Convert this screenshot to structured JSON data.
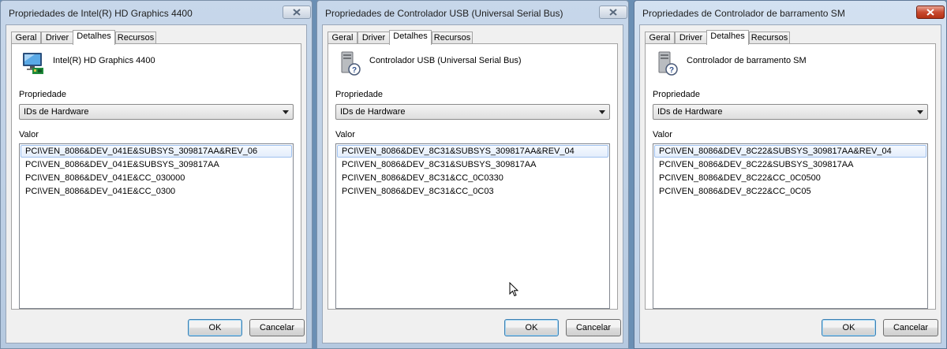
{
  "dialogs": [
    {
      "title": "Propriedades de Intel(R) HD Graphics 4400",
      "tabs": [
        "Geral",
        "Driver",
        "Detalhes",
        "Recursos"
      ],
      "selected_tab": "Detalhes",
      "device_name": "Intel(R) HD Graphics 4400",
      "device_icon": "display-adapter-icon",
      "property_label": "Propriedade",
      "property_value": "IDs de Hardware",
      "value_label": "Valor",
      "values": [
        "PCI\\VEN_8086&DEV_041E&SUBSYS_309817AA&REV_06",
        "PCI\\VEN_8086&DEV_041E&SUBSYS_309817AA",
        "PCI\\VEN_8086&DEV_041E&CC_030000",
        "PCI\\VEN_8086&DEV_041E&CC_0300"
      ],
      "ok_label": "OK",
      "cancel_label": "Cancelar"
    },
    {
      "title": "Propriedades de Controlador USB (Universal Serial Bus)",
      "tabs": [
        "Geral",
        "Driver",
        "Detalhes",
        "Recursos"
      ],
      "selected_tab": "Detalhes",
      "device_name": "Controlador USB (Universal Serial Bus)",
      "device_icon": "unknown-device-icon",
      "property_label": "Propriedade",
      "property_value": "IDs de Hardware",
      "value_label": "Valor",
      "values": [
        "PCI\\VEN_8086&DEV_8C31&SUBSYS_309817AA&REV_04",
        "PCI\\VEN_8086&DEV_8C31&SUBSYS_309817AA",
        "PCI\\VEN_8086&DEV_8C31&CC_0C0330",
        "PCI\\VEN_8086&DEV_8C31&CC_0C03"
      ],
      "ok_label": "OK",
      "cancel_label": "Cancelar"
    },
    {
      "title": "Propriedades de Controlador de barramento SM",
      "tabs": [
        "Geral",
        "Driver",
        "Detalhes",
        "Recursos"
      ],
      "selected_tab": "Detalhes",
      "device_name": "Controlador de barramento SM",
      "device_icon": "unknown-device-icon",
      "property_label": "Propriedade",
      "property_value": "IDs de Hardware",
      "value_label": "Valor",
      "values": [
        "PCI\\VEN_8086&DEV_8C22&SUBSYS_309817AA&REV_04",
        "PCI\\VEN_8086&DEV_8C22&SUBSYS_309817AA",
        "PCI\\VEN_8086&DEV_8C22&CC_0C0500",
        "PCI\\VEN_8086&DEV_8C22&CC_0C05"
      ],
      "ok_label": "OK",
      "cancel_label": "Cancelar"
    }
  ],
  "colors": {
    "desktop": "#6a8fb4",
    "selection_border": "#9fc1ef",
    "close_active": "#c94a30"
  }
}
